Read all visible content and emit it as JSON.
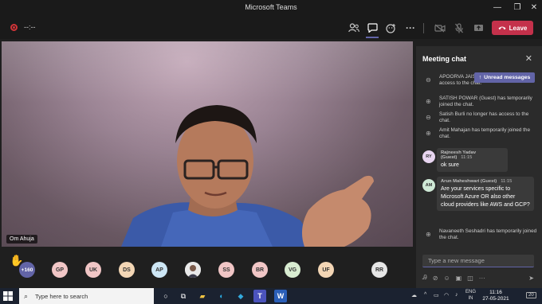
{
  "window": {
    "title": "Microsoft Teams",
    "minimize_icon": "minimize-icon",
    "maximize_icon": "maximize-icon",
    "close_icon": "close-icon"
  },
  "meeting_bar": {
    "timer": "--:--",
    "leave_label": "Leave",
    "recording_color": "#d13438",
    "leave_color": "#c4314b",
    "accent": "#6264a7"
  },
  "video": {
    "participant_name": "Om Ahuja"
  },
  "participants": {
    "raised_hand": "✋",
    "overflow_count": "+160",
    "avatars": [
      {
        "initials": "GP",
        "color": "#f1c6c6"
      },
      {
        "initials": "UK",
        "color": "#f1c6c6"
      },
      {
        "initials": "DS",
        "color": "#f3d6b5"
      },
      {
        "initials": "AP",
        "color": "#cde6f5"
      },
      {
        "initials": "",
        "color": "#e0e0e0",
        "photo": true
      },
      {
        "initials": "SS",
        "color": "#f1c6c6"
      },
      {
        "initials": "BR",
        "color": "#f1c6c6"
      },
      {
        "initials": "VG",
        "color": "#d8ecd1"
      },
      {
        "initials": "UF",
        "color": "#f3d6b5"
      },
      {
        "initials": "RR",
        "color": "#e6e6e6"
      }
    ]
  },
  "chat": {
    "title": "Meeting chat",
    "unread_label": "Unread messages",
    "system_messages": [
      "APOORVA JAISWAL/IHQ/IT longer has access to the chat.",
      "SATISH POWAR (Guest) has temporarily joined the chat.",
      "Satish Burli no longer has access to the chat.",
      "Amit Mahajan has temporarily joined the chat."
    ],
    "messages": [
      {
        "initials": "RY",
        "avatar_color": "#e8d5f0",
        "sender": "Rajneesh Yadav (Guest)",
        "time": "11:15",
        "body": "ok sure"
      },
      {
        "initials": "AM",
        "avatar_color": "#cfe9d6",
        "sender": "Arun Maheshwari (Guest)",
        "time": "11:15",
        "body": "Are your services specific to Microsoft Azure OR also other cloud providers like AWS and GCP?"
      }
    ],
    "last_system_message": "Navaneeth Seshadri has temporarily joined the chat.",
    "compose_placeholder": "Type a new message"
  },
  "taskbar": {
    "search_placeholder": "Type here to search",
    "language": "ENG",
    "language_region": "IN",
    "time": "11:16",
    "date": "27-05-2021",
    "notification_count": "20"
  }
}
